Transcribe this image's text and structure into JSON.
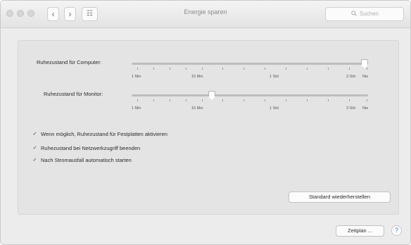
{
  "window": {
    "title": "Energie sparen",
    "search_placeholder": "Suchen",
    "search_icon": "magnifier-icon",
    "nav": {
      "back_glyph": "‹",
      "forward_glyph": "›",
      "grid_glyph": "☷"
    }
  },
  "sliders": [
    {
      "label": "Ruhezustand für Computer:",
      "tick_labels": [
        "1 Min",
        "15 Min",
        "1 Std",
        "3 Std",
        "Nie"
      ],
      "value": "Nie",
      "position_fraction": 0.985
    },
    {
      "label": "Ruhezustand für Monitor:",
      "tick_labels": [
        "1 Min",
        "15 Min",
        "1 Std",
        "3 Std",
        "Nie"
      ],
      "value": "15 Min",
      "position_fraction": 0.34
    }
  ],
  "checkboxes": [
    {
      "label": "Wenn möglich, Ruhezustand für Festplatten aktivieren",
      "checked": true,
      "mark": "✓"
    },
    {
      "label": "Ruhezustand bei Netzwerkzugriff beenden",
      "checked": true,
      "mark": "✓"
    },
    {
      "label": "Nach Stromausfall automatisch starten",
      "checked": true,
      "mark": "✓"
    }
  ],
  "buttons": {
    "restore_defaults": "Standard wiederherstellen",
    "schedule": "Zeitplan ...",
    "help": "?"
  }
}
